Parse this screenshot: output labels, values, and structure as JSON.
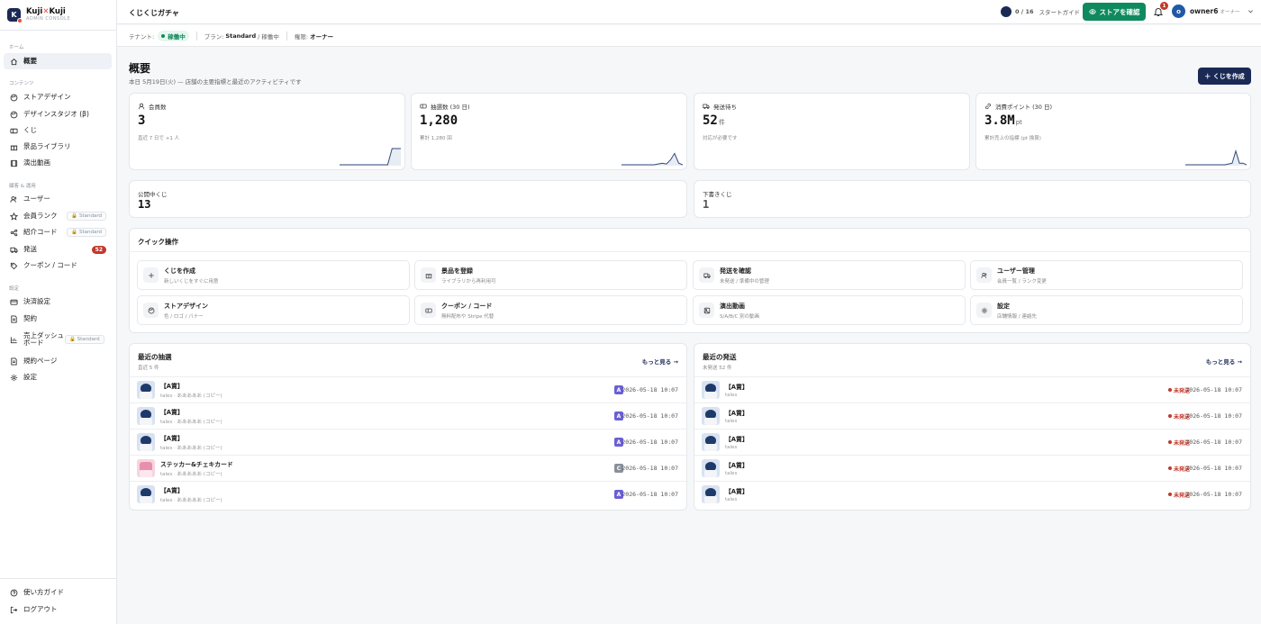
{
  "brand": {
    "name_a": "Kuji",
    "name_x": "✕",
    "name_b": "Kuji",
    "sub": "ADMIN CONSOLE",
    "logo_letter": "K"
  },
  "sidebar": {
    "sections": [
      "ホーム",
      "コンテンツ",
      "顧客 & 運用",
      "設定"
    ],
    "items": [
      {
        "label": "概要"
      },
      {
        "label": "ストアデザイン"
      },
      {
        "label": "デザインスタジオ (β)"
      },
      {
        "label": "くじ"
      },
      {
        "label": "景品ライブラリ"
      },
      {
        "label": "演出動画"
      },
      {
        "label": "ユーザー"
      },
      {
        "label": "会員ランク",
        "tag": "Standard"
      },
      {
        "label": "紹介コード",
        "tag": "Standard"
      },
      {
        "label": "発送",
        "count": "52"
      },
      {
        "label": "クーポン / コード"
      },
      {
        "label": "決済設定"
      },
      {
        "label": "契約"
      },
      {
        "label": "売上ダッシュボード",
        "tag": "Standard"
      },
      {
        "label": "規約ページ"
      },
      {
        "label": "設定"
      },
      {
        "label": "使い方ガイド"
      },
      {
        "label": "ログアウト"
      }
    ]
  },
  "topbar": {
    "title": "くじくじガチャ",
    "guide_done": "0",
    "guide_sep": "/",
    "guide_total": "16",
    "guide_label": "スタートガイド",
    "store_button": "ストアを確認",
    "notif_count": "1",
    "user_initial": "o",
    "user_name": "owner6",
    "user_role": "オーナー"
  },
  "tenant": {
    "tenant_label": "テナント:",
    "status": "稼働中",
    "plan_label": "プラン:",
    "plan": "Standard",
    "plan_status": "/ 稼働中",
    "role_label": "権限:",
    "role": "オーナー"
  },
  "main": {
    "title": "概要",
    "subtitle": "本日 5月19日(火) — 店舗の主要指標と最近のアクティビティです",
    "create_button": "＋ くじを作成"
  },
  "stats": [
    {
      "label": "会員数",
      "value": "3",
      "unit": "",
      "note": "直近 7 日で +1 人",
      "spark": [
        0,
        0,
        0,
        0,
        0,
        0,
        0,
        0,
        0,
        0,
        0,
        0,
        1,
        1,
        1
      ]
    },
    {
      "label": "抽選数 (30 日)",
      "value": "1,280",
      "unit": "",
      "note": "累計 1,280 回",
      "spark": [
        0,
        0,
        0,
        0,
        0,
        0,
        0,
        0,
        0,
        0.05,
        0.1,
        0.05,
        0.3,
        0.7,
        0.1,
        0
      ]
    },
    {
      "label": "発送待ち",
      "value": "52",
      "unit": "件",
      "note": "対応が必要です",
      "spark": []
    },
    {
      "label": "消費ポイント (30 日)",
      "value": "3.8M",
      "unit": "pt",
      "note": "累計売上の指標 (pt 換算)",
      "spark": [
        0,
        0,
        0,
        0,
        0,
        0,
        0,
        0,
        0,
        0,
        0,
        0,
        0.05,
        0.1,
        0.85,
        0.1,
        0.1,
        0
      ]
    }
  ],
  "small_stats": [
    {
      "label": "公開中くじ",
      "value": "13"
    },
    {
      "label": "下書きくじ",
      "value": "1"
    }
  ],
  "quick": {
    "title": "クイック操作",
    "items": [
      {
        "title": "くじを作成",
        "sub": "新しいくじをすぐに用意",
        "icon": "plus-icon"
      },
      {
        "title": "景品を登録",
        "sub": "ライブラリから再利用可",
        "icon": "gift-icon"
      },
      {
        "title": "発送を確認",
        "sub": "未発送 / 準備中の管理",
        "icon": "truck-icon"
      },
      {
        "title": "ユーザー管理",
        "sub": "会員一覧 / ランク変更",
        "icon": "users-icon"
      },
      {
        "title": "ストアデザイン",
        "sub": "色 / ロゴ / バナー",
        "icon": "palette-icon"
      },
      {
        "title": "クーポン / コード",
        "sub": "無料配布や Stripe 代替",
        "icon": "ticket-icon"
      },
      {
        "title": "演出動画",
        "sub": "S/A/B/C 別の動画",
        "icon": "image-icon"
      },
      {
        "title": "設定",
        "sub": "店舗情報 / 連絡先",
        "icon": "gear-icon"
      }
    ]
  },
  "draws": {
    "title": "最近の抽選",
    "sub": "直近 5 件",
    "more": "もっと見る →",
    "rows": [
      {
        "title": "【A賞】",
        "sub": "tales · あああああ (コピー)",
        "rank": "A",
        "date": "2026-05-18 10:07"
      },
      {
        "title": "【A賞】",
        "sub": "tales · あああああ (コピー)",
        "rank": "A",
        "date": "2026-05-18 10:07"
      },
      {
        "title": "【A賞】",
        "sub": "tales · あああああ (コピー)",
        "rank": "A",
        "date": "2026-05-18 10:07"
      },
      {
        "title": "ステッカー&チェキカード",
        "sub": "tales · あああああ (コピー)",
        "rank": "C",
        "date": "2026-05-18 10:07"
      },
      {
        "title": "【A賞】",
        "sub": "tales · あああああ (コピー)",
        "rank": "A",
        "date": "2026-05-18 10:07"
      }
    ]
  },
  "shipments": {
    "title": "最近の発送",
    "sub": "未発送 52 件",
    "more": "もっと見る →",
    "rows": [
      {
        "title": "【A賞】",
        "sub": "tales",
        "status": "未発送",
        "date": "2026-05-18 10:07"
      },
      {
        "title": "【A賞】",
        "sub": "tales",
        "status": "未発送",
        "date": "2026-05-18 10:07"
      },
      {
        "title": "【A賞】",
        "sub": "tales",
        "status": "未発送",
        "date": "2026-05-18 10:07"
      },
      {
        "title": "【A賞】",
        "sub": "tales",
        "status": "未発送",
        "date": "2026-05-18 10:07"
      },
      {
        "title": "【A賞】",
        "sub": "tales",
        "status": "未発送",
        "date": "2026-05-18 10:07"
      }
    ]
  },
  "colors": {
    "accent_navy": "#1a2a55",
    "store_green": "#0f8a5f",
    "alert_red": "#c0392b",
    "rank_a": "#6b5fd3",
    "rank_c": "#8a8f98"
  }
}
